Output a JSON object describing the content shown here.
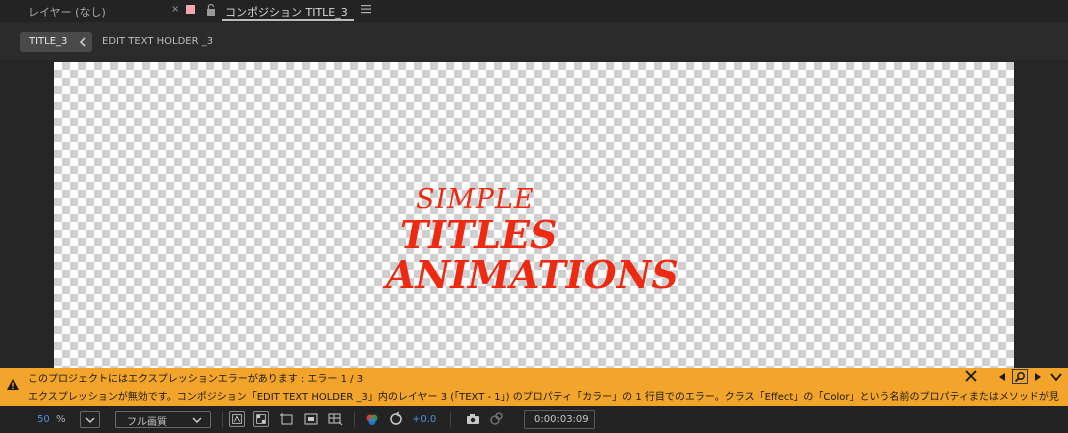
{
  "tabs": {
    "layer_tab": "レイヤー (なし)",
    "close_glyph": "×",
    "comp_tab": "コンポジション TITLE_3",
    "swatch_color": "#f0a7b0"
  },
  "breadcrumb": {
    "active": "TITLE_3",
    "next": "EDIT TEXT HOLDER _3"
  },
  "canvas": {
    "lines": [
      "SIMPLE",
      "TITLES",
      "ANIMATIONS"
    ],
    "text_color": "#ef2a12"
  },
  "error": {
    "line1": "このプロジェクトにはエクスプレッションエラーがあります : エラー 1 / 3",
    "line2": "エクスプレッションが無効です。コンポジション「EDIT TEXT HOLDER _3」内のレイヤー 3 (「TEXT  - 1」) のプロパティ「カラー」の 1 行目でのエラー。クラス「Effect」の「Color」という名前のプロパティまたはメソッドが見",
    "bg_color": "#f3a42a"
  },
  "toolbar": {
    "zoom_value": "50",
    "zoom_unit": "%",
    "resolution": "フル画質",
    "exposure": "+0.0",
    "timecode": "0:00:03:09"
  }
}
